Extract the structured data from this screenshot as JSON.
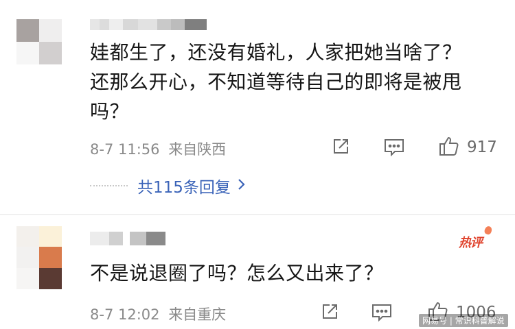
{
  "comments": [
    {
      "text_lines": [
        "娃都生了，还没有婚礼，人家把她当啥了？",
        "还那么开心，不知道等待自己的即将是被甩",
        "吗？"
      ],
      "date": "8-7 11:56",
      "location": "来自陕西",
      "likes": "917",
      "replies": "共115条回复"
    },
    {
      "text_lines": [
        "不是说退圈了吗？怎么又出来了？"
      ],
      "date": "8-7 12:02",
      "location": "来自重庆",
      "likes": "1006",
      "badge": "热评"
    }
  ],
  "icons": {
    "share": "share-icon",
    "comment": "comment-icon",
    "like": "thumbs-up-icon",
    "chevron": "chevron-right-icon"
  },
  "watermark": "网易号 | 常识科普解说",
  "colors": {
    "link": "#3a63b8",
    "meta": "#8a8a8a",
    "badge": "#e0452f"
  }
}
